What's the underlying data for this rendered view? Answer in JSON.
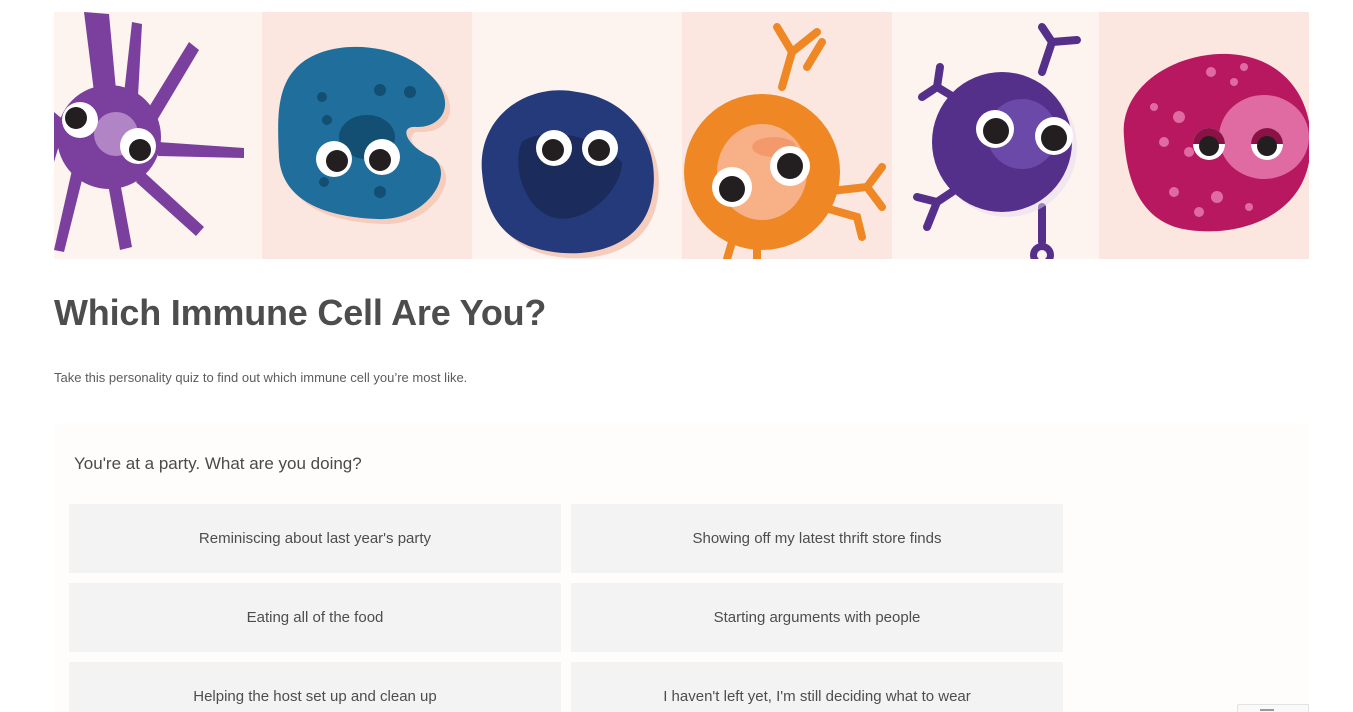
{
  "page": {
    "title": "Which Immune Cell Are You?",
    "subtitle": "Take this personality quiz to find out which immune cell you’re most like."
  },
  "banner": {
    "cells": [
      {
        "name": "purple spiky cell",
        "color": "#7b3f9e",
        "background": "#fdf4f0"
      },
      {
        "name": "blue amoeboid cell",
        "color": "#1f6e9c",
        "background": "#fbe7df"
      },
      {
        "name": "navy round cell",
        "color": "#253a7a",
        "background": "#fdf4f0"
      },
      {
        "name": "orange antibody cell",
        "color": "#ee8724",
        "background": "#fbe7df"
      },
      {
        "name": "indigo cell with receptors",
        "color": "#55308a",
        "background": "#fdf4f0"
      },
      {
        "name": "magenta granular cell",
        "color": "#b7185f",
        "background": "#fbe7df"
      }
    ]
  },
  "quiz": {
    "question": "You're at a party. What are you doing?",
    "answers": [
      "Reminiscing about last year's party",
      "Showing off my latest thrift store finds",
      "Eating all of the food",
      "Starting arguments with people",
      "Helping the host set up and clean up",
      "I haven't left yet, I'm still deciding what to wear"
    ]
  },
  "colors": {
    "title_text": "#4d4d4d",
    "answer_background": "#f3f3f3"
  }
}
